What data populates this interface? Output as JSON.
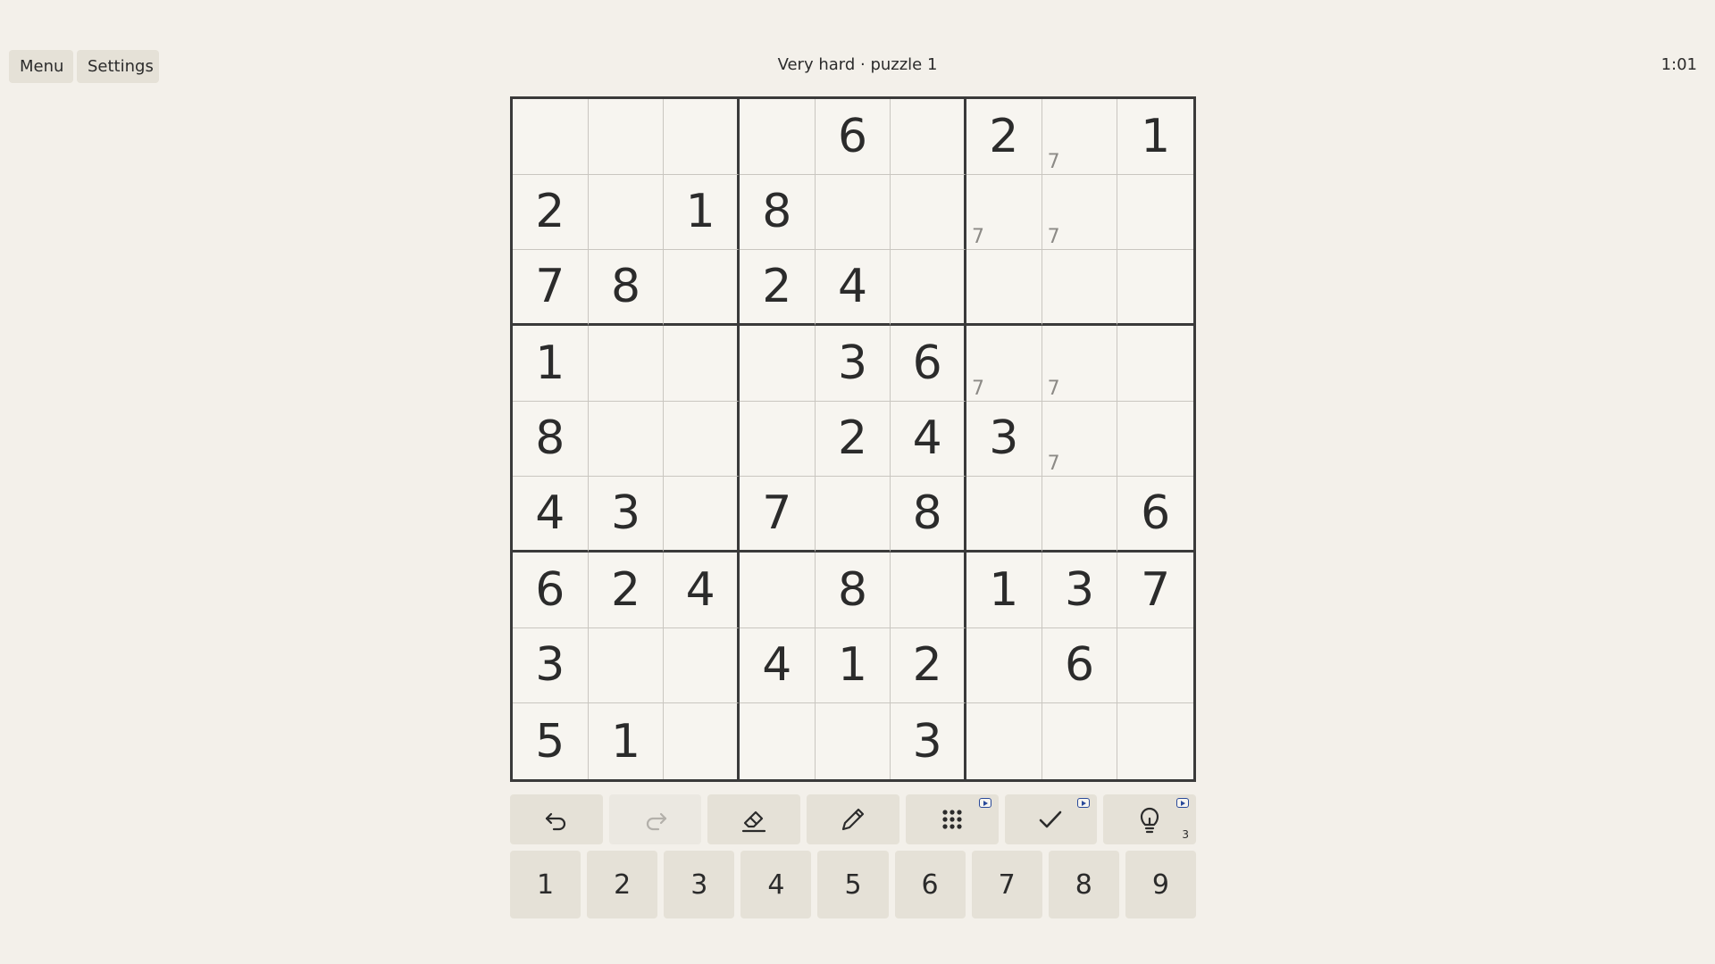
{
  "header": {
    "menu_label": "Menu",
    "settings_label": "Settings",
    "title": "Very hard · puzzle 1",
    "timer": "1:01"
  },
  "board": {
    "cells": [
      [
        "",
        "",
        "",
        "",
        "6",
        "",
        "2",
        "",
        "1"
      ],
      [
        "2",
        "",
        "1",
        "8",
        "",
        "",
        "",
        "",
        ""
      ],
      [
        "7",
        "8",
        "",
        "2",
        "4",
        "",
        "",
        "",
        ""
      ],
      [
        "1",
        "",
        "",
        "",
        "3",
        "6",
        "",
        "",
        ""
      ],
      [
        "8",
        "",
        "",
        "",
        "2",
        "4",
        "3",
        "",
        ""
      ],
      [
        "4",
        "3",
        "",
        "7",
        "",
        "8",
        "",
        "",
        "6"
      ],
      [
        "6",
        "2",
        "4",
        "",
        "8",
        "",
        "1",
        "3",
        "7"
      ],
      [
        "3",
        "",
        "",
        "4",
        "1",
        "2",
        "",
        "6",
        ""
      ],
      [
        "5",
        "1",
        "",
        "",
        "",
        "3",
        "",
        "",
        ""
      ]
    ],
    "notes": [
      [
        "",
        "",
        "",
        "",
        "",
        "",
        "",
        "7",
        ""
      ],
      [
        "",
        "",
        "",
        "",
        "",
        "",
        "7",
        "7",
        ""
      ],
      [
        "",
        "",
        "",
        "",
        "",
        "",
        "",
        "",
        ""
      ],
      [
        "",
        "",
        "",
        "",
        "",
        "",
        "7",
        "7",
        ""
      ],
      [
        "",
        "",
        "",
        "",
        "",
        "",
        "",
        "7",
        ""
      ],
      [
        "",
        "",
        "",
        "",
        "",
        "",
        "",
        "",
        ""
      ],
      [
        "",
        "",
        "",
        "",
        "",
        "",
        "",
        "",
        ""
      ],
      [
        "",
        "",
        "",
        "",
        "",
        "",
        "",
        "",
        ""
      ],
      [
        "",
        "",
        "",
        "",
        "",
        "",
        "",
        "",
        ""
      ]
    ]
  },
  "toolbar": {
    "tools": [
      {
        "name": "undo",
        "icon": "undo-icon",
        "enabled": true,
        "badge": false
      },
      {
        "name": "redo",
        "icon": "redo-icon",
        "enabled": false,
        "badge": false
      },
      {
        "name": "erase",
        "icon": "eraser-icon",
        "enabled": true,
        "badge": false
      },
      {
        "name": "notes",
        "icon": "pencil-icon",
        "enabled": true,
        "badge": false
      },
      {
        "name": "auto-notes",
        "icon": "grid-dots-icon",
        "enabled": true,
        "badge": true
      },
      {
        "name": "check",
        "icon": "check-icon",
        "enabled": true,
        "badge": true
      },
      {
        "name": "hint",
        "icon": "lightbulb-icon",
        "enabled": true,
        "badge": true
      }
    ],
    "hint_count": "3"
  },
  "numpad": {
    "keys": [
      "1",
      "2",
      "3",
      "4",
      "5",
      "6",
      "7",
      "8",
      "9"
    ]
  },
  "colors": {
    "background": "#f3f0ea",
    "button": "#e5e1d7",
    "digit": "#2b2b2b",
    "note": "#8c8a86",
    "badge": "#2a4a9a"
  }
}
